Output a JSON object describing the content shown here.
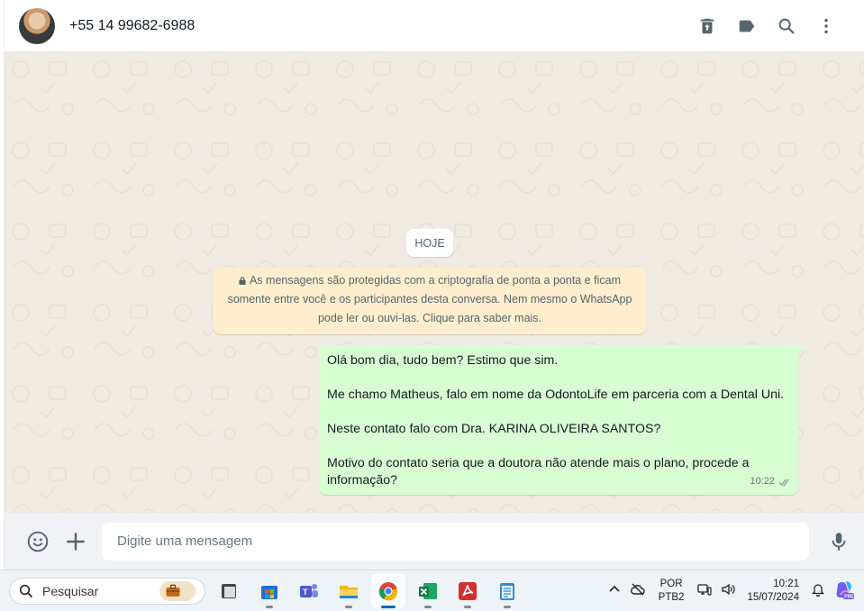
{
  "header": {
    "contact_name": "+55 14 99682-6988",
    "actions": [
      "delete-icon",
      "label-icon",
      "search-icon",
      "menu-icon"
    ]
  },
  "chat": {
    "date_chip": "HOJE",
    "encryption_note": [
      "As mensagens são protegidas com a criptografia de ponta a ponta e ficam",
      "somente entre você e os participantes desta conversa. Nem mesmo o WhatsApp",
      "pode ler ou ouvi-las. Clique para saber mais."
    ],
    "messages": [
      {
        "direction": "outgoing",
        "lines": [
          "Olá bom dia, tudo bem? Estimo que sim.",
          "",
          "Me chamo Matheus, falo em nome da OdontoLife em parceria com a Dental Uni.",
          "",
          "Neste contato falo com Dra. KARINA OLIVEIRA SANTOS?",
          "",
          "Motivo do contato seria que a doutora não atende mais o plano, procede a",
          "informação?"
        ],
        "time": "10:22",
        "status": "delivered"
      }
    ]
  },
  "composer": {
    "placeholder": "Digite uma mensagem"
  },
  "taskbar": {
    "search_label": "Pesquisar",
    "apps": [
      "explorer-dark",
      "microsoft-store",
      "teams",
      "file-explorer",
      "chrome",
      "excel",
      "acrobat",
      "notepad"
    ],
    "active_app": "chrome",
    "language": "POR",
    "layout": "PTB2",
    "time": "10:21",
    "date": "15/07/2024"
  },
  "colors": {
    "header_bg": "#ffffff",
    "chat_bg": "#efeae2",
    "outgoing_bubble": "#d9fdd3",
    "system_note": "#ffeecd",
    "composer_bg": "#f0f2f5",
    "taskbar_bg": "#eef3f8",
    "accent": "#0067c0"
  }
}
